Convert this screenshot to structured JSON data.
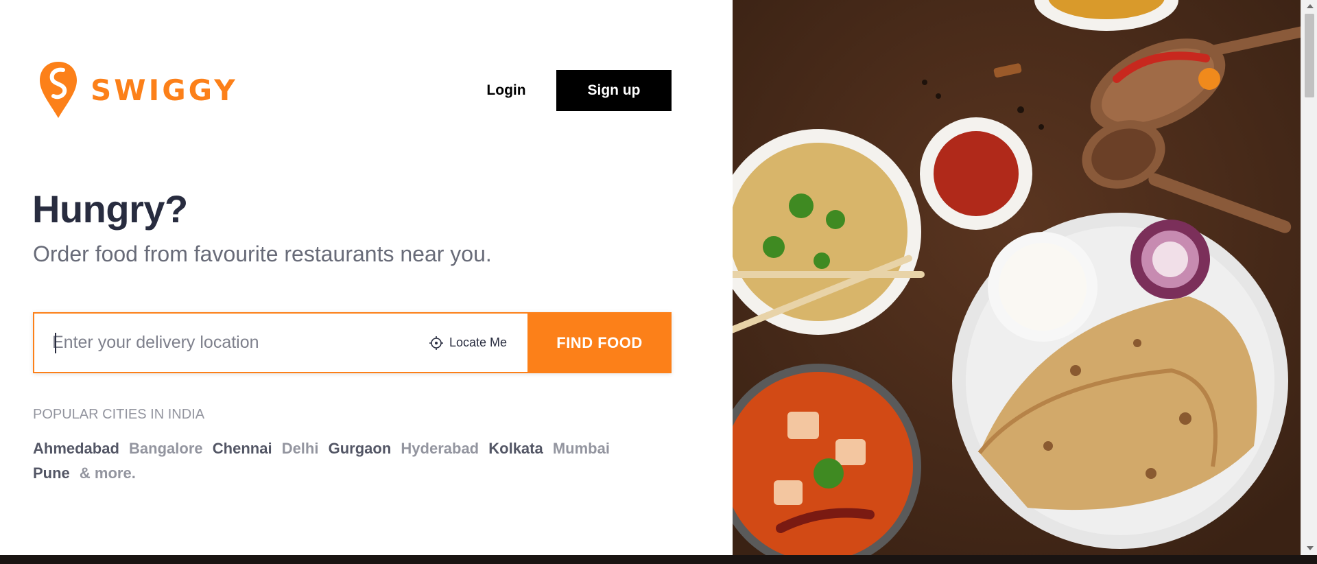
{
  "brand": {
    "name": "SWIGGY",
    "color": "#fc8019"
  },
  "header": {
    "login_label": "Login",
    "signup_label": "Sign up"
  },
  "hero": {
    "title": "Hungry?",
    "subtitle": "Order food from favourite restaurants near you."
  },
  "search": {
    "placeholder": "Enter your delivery location",
    "locate_label": "Locate Me",
    "find_label": "FIND FOOD"
  },
  "popular": {
    "title": "POPULAR CITIES IN INDIA",
    "cities": [
      {
        "name": "Ahmedabad",
        "tone": "dark"
      },
      {
        "name": "Bangalore",
        "tone": "light"
      },
      {
        "name": "Chennai",
        "tone": "dark"
      },
      {
        "name": "Delhi",
        "tone": "light"
      },
      {
        "name": "Gurgaon",
        "tone": "dark"
      },
      {
        "name": "Hyderabad",
        "tone": "light"
      },
      {
        "name": "Kolkata",
        "tone": "dark"
      },
      {
        "name": "Mumbai",
        "tone": "light"
      },
      {
        "name": "Pune",
        "tone": "dark"
      },
      {
        "name": "& more.",
        "tone": "light"
      }
    ]
  },
  "icons": {
    "logo": "swiggy-pin-logo",
    "locate": "crosshair-icon"
  }
}
